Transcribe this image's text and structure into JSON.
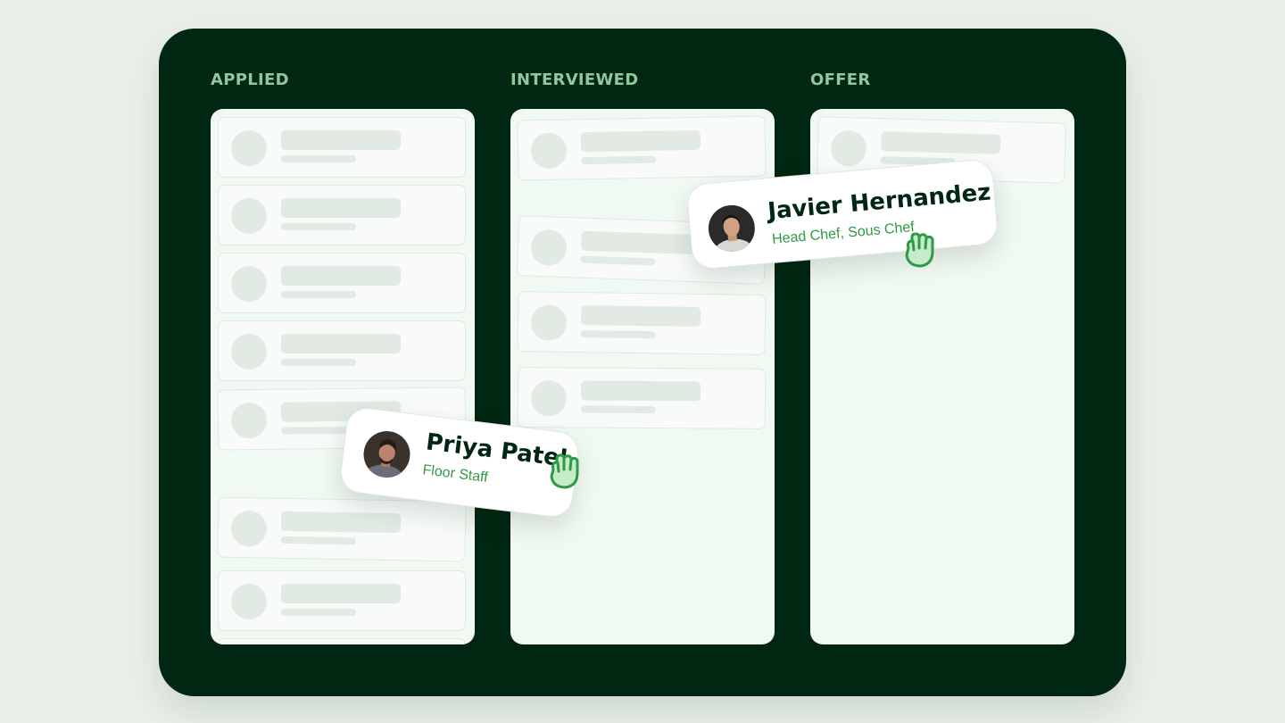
{
  "columns": [
    {
      "title": "APPLIED"
    },
    {
      "title": "INTERVIEWED"
    },
    {
      "title": "OFFER"
    }
  ],
  "dragging": [
    {
      "name": "Javier Hernandez",
      "role": "Head Chef, Sous Chef"
    },
    {
      "name": "Priya Patel",
      "role": "Floor Staff"
    }
  ],
  "colors": {
    "board": "#012611",
    "accent": "#2f9a45",
    "column_bg": "#f1f9f3",
    "skeleton": "#e1ebe3"
  },
  "icons": [
    "grab-hand-icon",
    "avatar"
  ]
}
